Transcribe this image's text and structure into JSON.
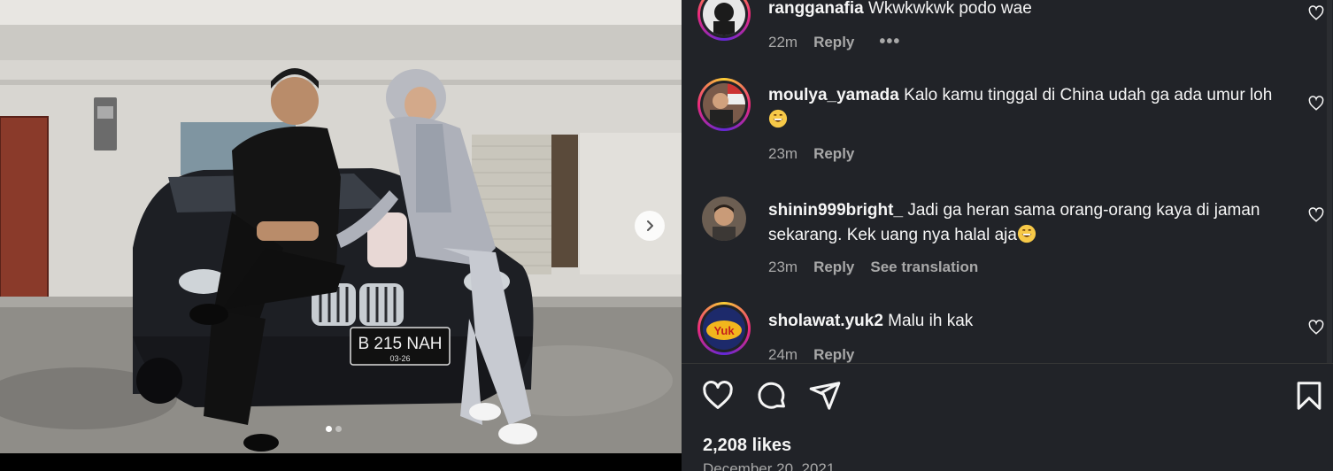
{
  "post": {
    "image_alt": "",
    "plate_text": "B 215 NAH",
    "plate_sub": "03-26",
    "carousel": {
      "count": 2,
      "active_index": 0
    }
  },
  "comments": [
    {
      "username": "rangganafia",
      "text": "Wkwkwkwk podo wae",
      "time": "22m",
      "reply": "Reply",
      "extra": "",
      "has_more": true
    },
    {
      "username": "moulya_yamada",
      "text": "Kalo kamu tinggal di China udah ga ada umur loh",
      "time": "23m",
      "reply": "Reply",
      "extra": "",
      "emoji": "grinning-sweat"
    },
    {
      "username": "shinin999bright_",
      "text": "Jadi ga heran sama orang-orang kaya di jaman sekarang. Kek uang nya halal aja",
      "time": "23m",
      "reply": "Reply",
      "extra": "See translation",
      "emoji": "grinning-sweat"
    },
    {
      "username": "sholawat.yuk2",
      "text": "Malu ih kak",
      "time": "24m",
      "reply": "Reply",
      "extra": "",
      "avatar_text": "Yuk"
    }
  ],
  "actions": {
    "like": "heart-icon",
    "comment": "comment-icon",
    "share": "share-icon",
    "save": "bookmark-icon"
  },
  "likes_text": "2,208 likes",
  "date_text": "December 20, 2021",
  "colors": {
    "background": "#212328",
    "text": "#f5f5f5",
    "muted": "#a8a8a8"
  }
}
